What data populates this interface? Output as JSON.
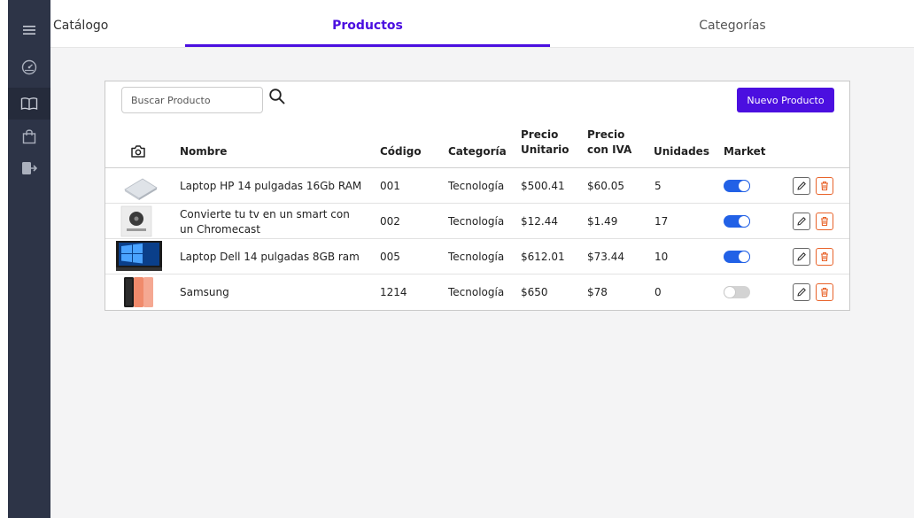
{
  "app": {
    "brand": "Catálogo"
  },
  "tabs": [
    {
      "label": "Productos",
      "active": true
    },
    {
      "label": "Categorías",
      "active": false
    }
  ],
  "sidebar": {
    "items": [
      {
        "icon": "menu-icon"
      },
      {
        "icon": "dashboard-gauge-icon"
      },
      {
        "icon": "book-icon",
        "active": true
      },
      {
        "icon": "shopping-bag-icon"
      },
      {
        "icon": "logout-icon"
      }
    ]
  },
  "toolbar": {
    "search_placeholder": "Buscar Producto",
    "search_value": "",
    "new_button": "Nuevo Producto"
  },
  "table": {
    "headers": {
      "image": "camera-icon",
      "nombre": "Nombre",
      "codigo": "Código",
      "categoria": "Categoría",
      "precio_unitario_1": "Precio",
      "precio_unitario_2": "Unitario",
      "precio_iva_1": "Precio",
      "precio_iva_2": "con IVA",
      "unidades": "Unidades",
      "market": "Market"
    },
    "rows": [
      {
        "image": "laptop-hp-photo",
        "nombre": "Laptop HP 14 pulgadas 16Gb RAM",
        "codigo": "001",
        "categoria": "Tecnología",
        "precio_unitario": "$500.41",
        "precio_iva": "$60.05",
        "unidades": "5",
        "market": true
      },
      {
        "image": "chromecast-photo",
        "nombre": "Convierte tu tv en un smart con un Chromecast",
        "codigo": "002",
        "categoria": "Tecnología",
        "precio_unitario": "$12.44",
        "precio_iva": "$1.49",
        "unidades": "17",
        "market": true
      },
      {
        "image": "laptop-dell-photo",
        "nombre": "Laptop Dell 14 pulgadas 8GB ram",
        "codigo": "005",
        "categoria": "Tecnología",
        "precio_unitario": "$612.01",
        "precio_iva": "$73.44",
        "unidades": "10",
        "market": true
      },
      {
        "image": "samsung-phone-photo",
        "nombre": "Samsung",
        "codigo": "1214",
        "categoria": "Tecnología",
        "precio_unitario": "$650",
        "precio_iva": "$78",
        "unidades": "0",
        "market": false
      }
    ]
  },
  "colors": {
    "accent": "#4b0fe0",
    "sidebar": "#2d3447",
    "toggle_on": "#2261e6",
    "delete": "#e8632a"
  }
}
